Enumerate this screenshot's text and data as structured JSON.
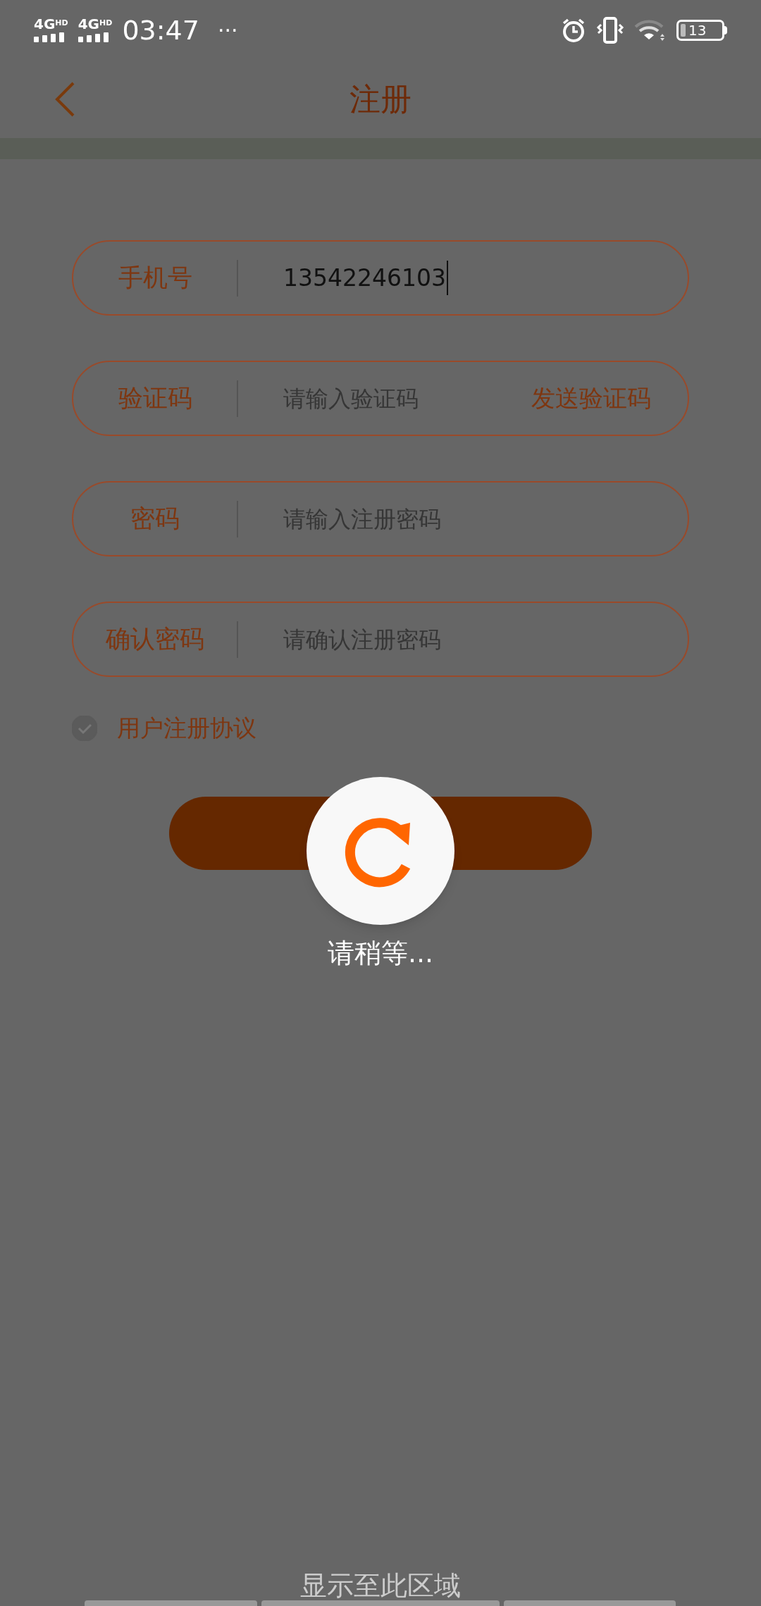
{
  "status_bar": {
    "network_1": "4G",
    "network_1_sup": "HD",
    "network_2": "4G",
    "network_2_sup": "HD",
    "time": "03:47",
    "more": "···",
    "battery": "13"
  },
  "header": {
    "title": "注册"
  },
  "fields": [
    {
      "label": "手机号",
      "value": "13542246103"
    },
    {
      "label": "验证码",
      "placeholder": "请输入验证码",
      "action": "发送验证码"
    },
    {
      "label": "密码",
      "placeholder": "请输入注册密码"
    },
    {
      "label": "确认密码",
      "placeholder": "请确认注册密码"
    }
  ],
  "agreement": {
    "label": "用户注册协议",
    "checked": true
  },
  "loading": {
    "text": "请稍等..."
  },
  "bottom_hint": "显示至此区域"
}
